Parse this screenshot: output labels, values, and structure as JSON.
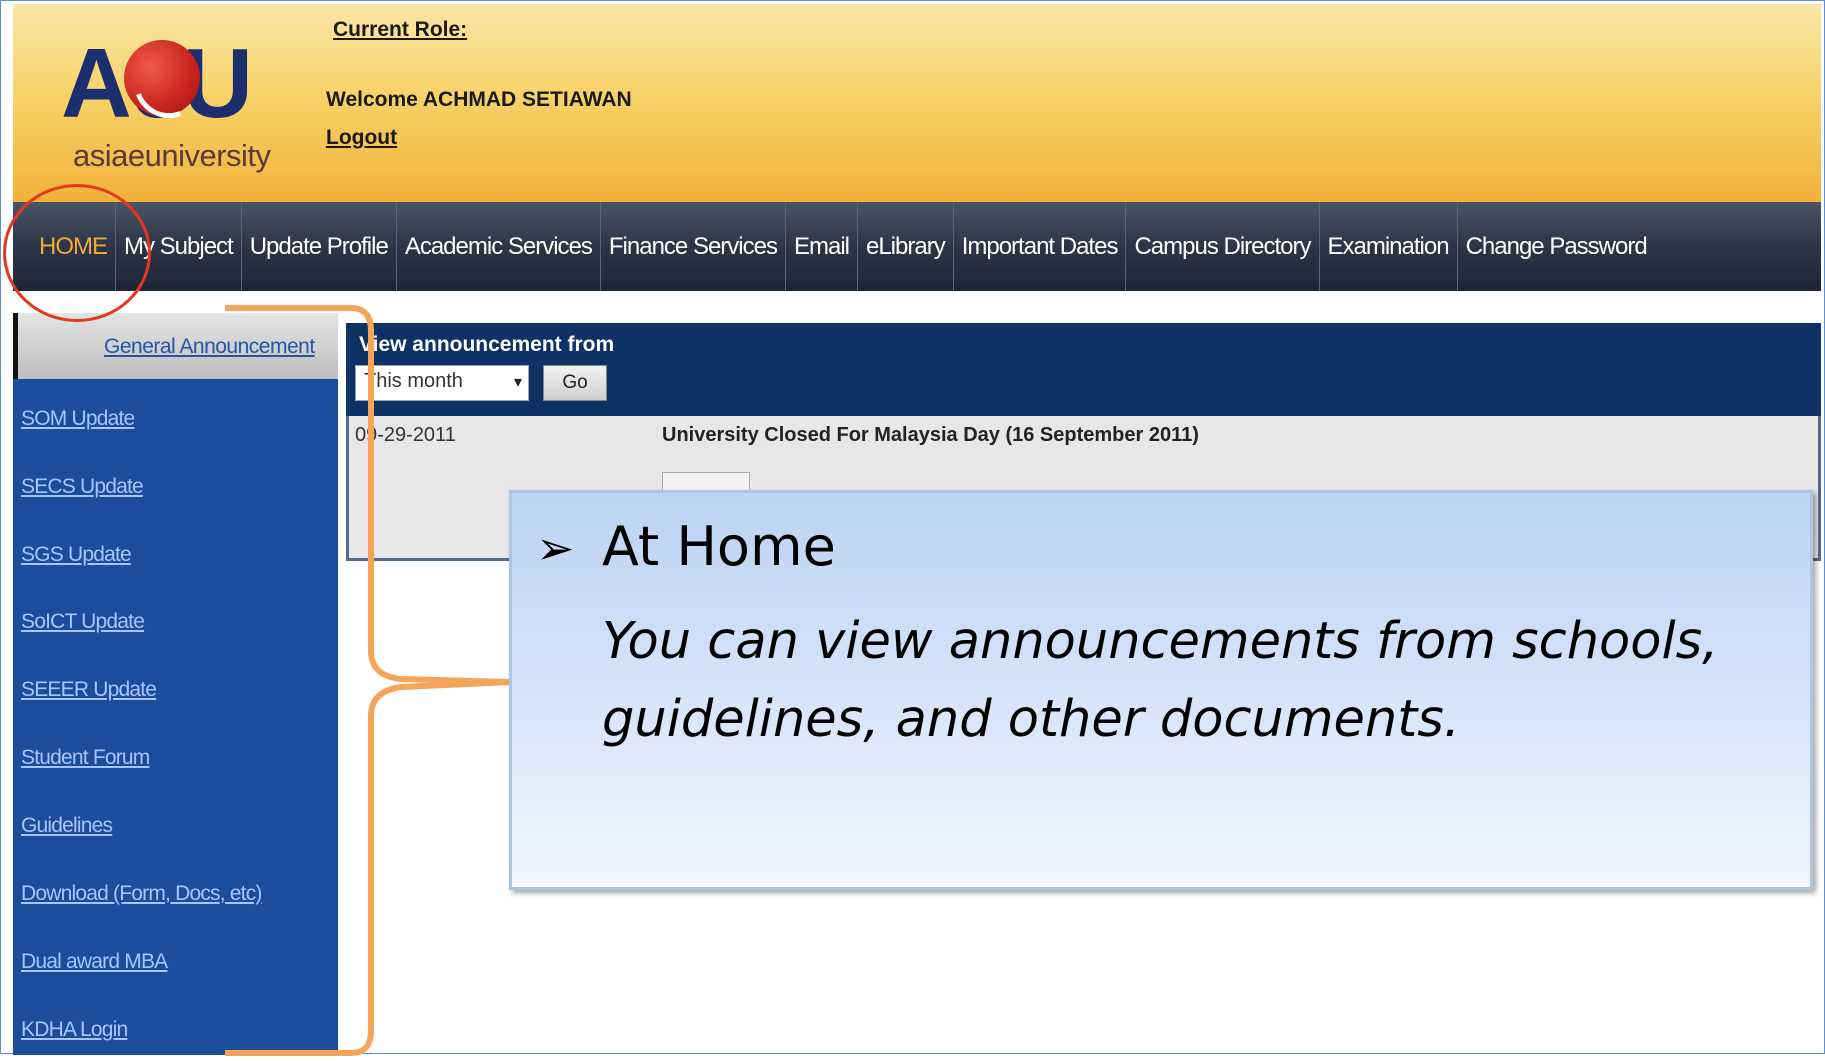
{
  "header": {
    "logo_text": "AeU",
    "logo_sub": "asiaeuniversity",
    "current_role_label": "Current Role:",
    "welcome_text": "Welcome ACHMAD SETIAWAN",
    "logout_label": "Logout"
  },
  "nav": {
    "items": [
      {
        "label": "HOME",
        "active": true
      },
      {
        "label": "My Subject"
      },
      {
        "label": "Update Profile"
      },
      {
        "label": "Academic Services"
      },
      {
        "label": "Finance Services"
      },
      {
        "label": "Email"
      },
      {
        "label": "eLibrary"
      },
      {
        "label": "Important Dates"
      },
      {
        "label": "Campus Directory"
      },
      {
        "label": "Examination"
      },
      {
        "label": "Change Password"
      }
    ]
  },
  "sidebar": {
    "general_announcement": "General Announcement",
    "links": [
      "SOM Update",
      "SECS Update",
      "SGS Update",
      "SoICT Update",
      "SEEER Update",
      "Student Forum",
      "Guidelines",
      "Download (Form, Docs, etc)",
      "Dual award MBA",
      "KDHA Login"
    ]
  },
  "content": {
    "view_from_label": "View announcement from",
    "period_selected": "This month",
    "go_label": "Go",
    "announcement_date": "09-29-2011",
    "announcement_title": "University Closed For Malaysia Day (16 September 2011)"
  },
  "callout": {
    "arrow": "➢",
    "heading": "At Home",
    "body": "You can view announcements from schools, guidelines, and other documents."
  },
  "colors": {
    "header_gold": "#f2b23a",
    "nav_dark": "#2c3547",
    "sidebar_blue": "#1b4d9c",
    "content_navy": "#0e3266",
    "highlight_red": "#e4371f",
    "bracket_orange": "#f5a55a",
    "active_nav": "#f2a93b"
  }
}
